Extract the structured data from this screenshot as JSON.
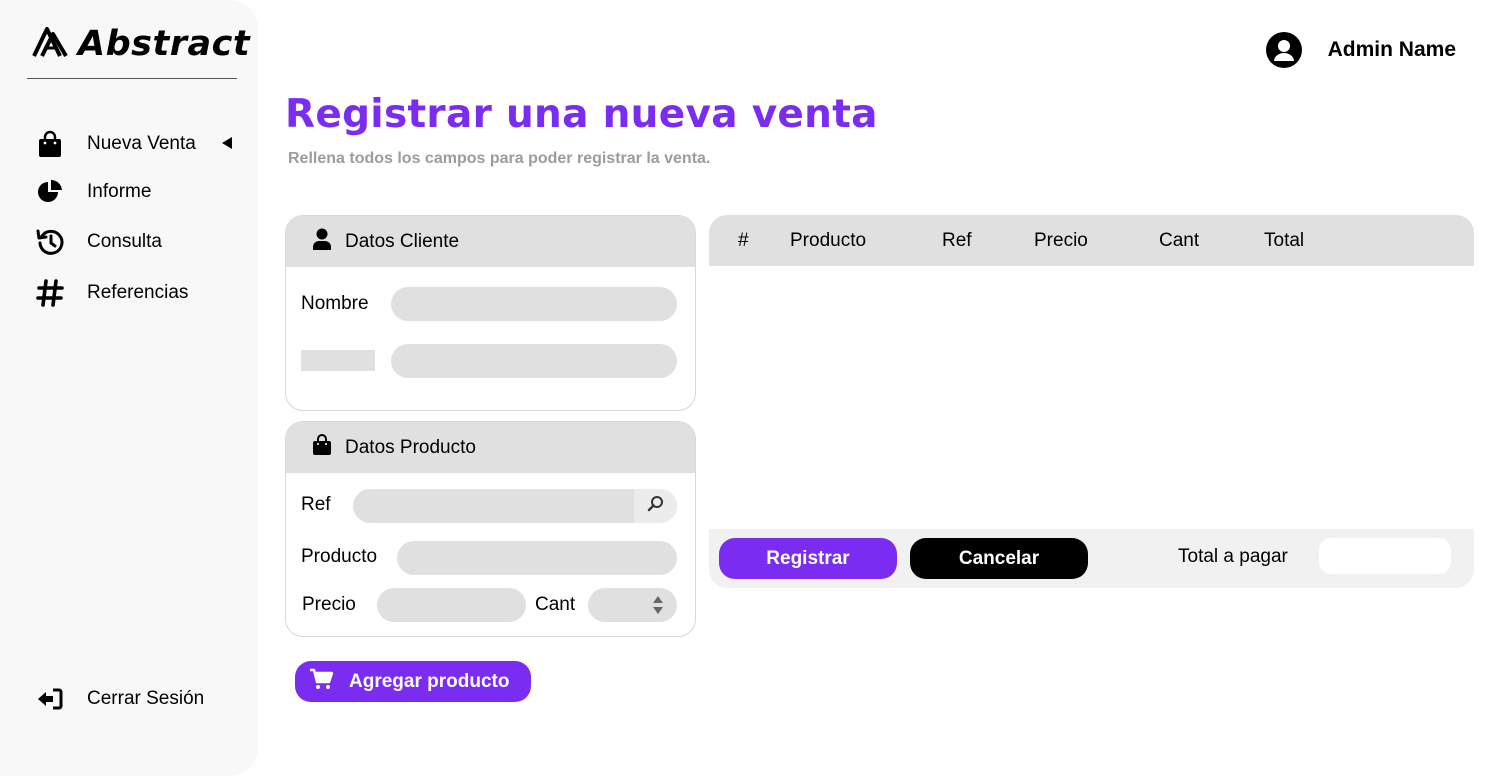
{
  "brand": {
    "name": "Abstract"
  },
  "sidebar": {
    "items": [
      {
        "label": "Nueva Venta",
        "icon": "shopping-bag-icon",
        "active": true
      },
      {
        "label": "Informe",
        "icon": "pie-chart-icon"
      },
      {
        "label": "Consulta",
        "icon": "history-icon"
      },
      {
        "label": "Referencias",
        "icon": "hashtag-icon"
      }
    ],
    "logout": {
      "label": "Cerrar Sesión",
      "icon": "sign-out-icon"
    }
  },
  "header": {
    "user_name": "Admin Name",
    "icon": "user-circle-icon"
  },
  "page": {
    "title": "Registrar una nueva venta",
    "subtitle": "Rellena todos los campos para poder registrar la venta."
  },
  "cliente": {
    "title": "Datos Cliente",
    "nombre_label": "Nombre",
    "nombre_value": "",
    "second_value": ""
  },
  "producto": {
    "title": "Datos Producto",
    "ref_label": "Ref",
    "producto_label": "Producto",
    "precio_label": "Precio",
    "cant_label": "Cant"
  },
  "add_button": {
    "label": "Agregar producto"
  },
  "table": {
    "headers": [
      "#",
      "Producto",
      "Ref",
      "Precio",
      "Cant",
      "Total"
    ],
    "rows": []
  },
  "footer": {
    "register_label": "Registrar",
    "cancel_label": "Cancelar",
    "total_label": "Total a pagar",
    "total_value": ""
  },
  "colors": {
    "accent": "#7a2df0",
    "panel_gray": "#e0e0e0",
    "sidebar_bg": "#f8f8f8"
  }
}
